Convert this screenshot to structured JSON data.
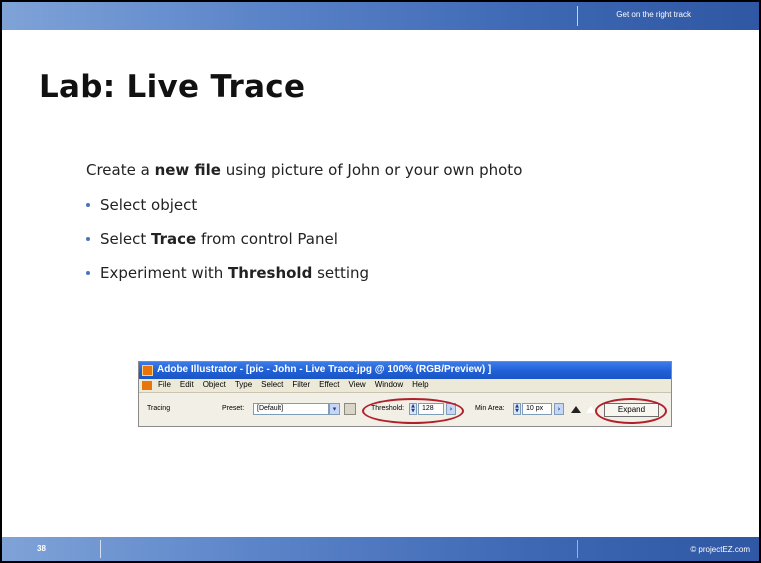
{
  "header": {
    "tagline": "Get on the right track"
  },
  "slide": {
    "title": "Lab:  Live Trace",
    "intro": {
      "pre": "Create a ",
      "bold": "new file",
      "post": " using picture of John or your own photo"
    },
    "bullets": [
      {
        "pre": "Select object",
        "bold": "",
        "post": ""
      },
      {
        "pre": "Select ",
        "bold": "Trace",
        "post": " from control Panel"
      },
      {
        "pre": "Experiment with ",
        "bold": "Threshold",
        "post": " setting"
      }
    ]
  },
  "screenshot": {
    "window_title": "Adobe Illustrator - [pic - John -  Live Trace.jpg @ 100% (RGB/Preview) ]",
    "menu": [
      "File",
      "Edit",
      "Object",
      "Type",
      "Select",
      "Filter",
      "Effect",
      "View",
      "Window",
      "Help"
    ],
    "control": {
      "tracing_label": "Tracing",
      "preset_label": "Preset:",
      "preset_value": "[Default]",
      "threshold_label": "Threshold:",
      "threshold_value": "128",
      "min_area_label": "Min Area:",
      "min_area_value": "10 px",
      "expand_label": "Expand"
    },
    "highlight_color": "#b0202a"
  },
  "footer": {
    "page_number": "38",
    "copyright": "© projectEZ.com"
  },
  "colors": {
    "bar_blue": "#3e68b4",
    "bullet": "#4a74bf"
  }
}
